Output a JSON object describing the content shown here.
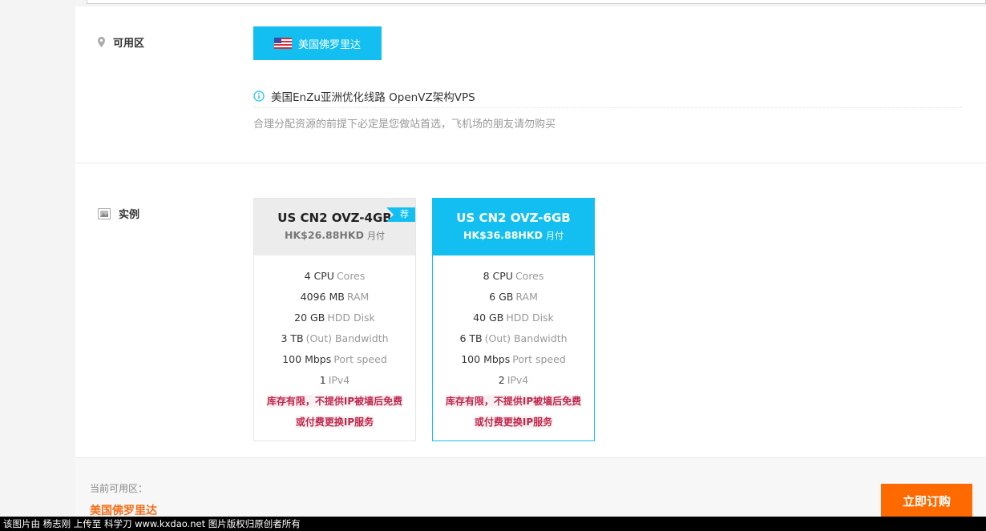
{
  "zone": {
    "label": "可用区",
    "icon": "map-pin-icon",
    "region_button": "美国佛罗里达",
    "info": "美国EnZu亚洲优化线路 OpenVZ架构VPS",
    "description": "合理分配资源的前提下必定是您做站首选，飞机场的朋友请勿购买"
  },
  "instance": {
    "label": "实例",
    "icon": "image-frame-icon",
    "cards": [
      {
        "name": "US CN2 OVZ-4GB",
        "price": "HK$26.88HKD",
        "cycle": "月付",
        "ribbon": "荐",
        "specs": [
          {
            "value": "4 CPU",
            "unit": "Cores"
          },
          {
            "value": "4096 MB",
            "unit": "RAM"
          },
          {
            "value": "20 GB",
            "unit": "HDD Disk"
          },
          {
            "value": "3 TB",
            "unit": "(Out) Bandwidth"
          },
          {
            "value": "100 Mbps",
            "unit": "Port speed"
          },
          {
            "value": "1",
            "unit": "IPv4"
          }
        ],
        "warning_1": "库存有限，不提供IP被墙后免费",
        "warning_2": "或付费更换IP服务"
      },
      {
        "name": "US CN2 OVZ-6GB",
        "price": "HK$36.88HKD",
        "cycle": "月付",
        "specs": [
          {
            "value": "8 CPU",
            "unit": "Cores"
          },
          {
            "value": "6 GB",
            "unit": "RAM"
          },
          {
            "value": "40 GB",
            "unit": "HDD Disk"
          },
          {
            "value": "6 TB",
            "unit": "(Out) Bandwidth"
          },
          {
            "value": "100 Mbps",
            "unit": "Port speed"
          },
          {
            "value": "2",
            "unit": "IPv4"
          }
        ],
        "warning_1": "库存有限，不提供IP被墙后免费",
        "warning_2": "或付费更换IP服务"
      }
    ]
  },
  "footer": {
    "current_label": "当前可用区：",
    "current_value": "美国佛罗里达",
    "order_button": "立即订购"
  },
  "watermark": "该图片由 杨志刚 上传至 科学刀 www.kxdao.net 图片版权归原创者所有",
  "colors": {
    "accent": "#12bff0",
    "order": "#ff6a00",
    "warning": "#c1264a",
    "current_value": "#f56e1a"
  }
}
